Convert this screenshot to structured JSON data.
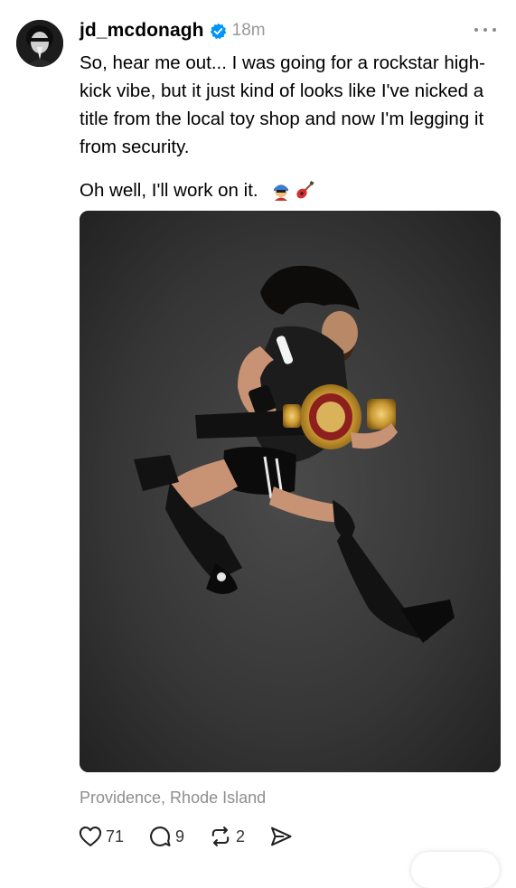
{
  "post": {
    "author": {
      "username": "jd_mcdonagh",
      "verified": true,
      "avatar_icon": "avatar-praying-hands"
    },
    "time": "18m",
    "more_icon": "ellipsis-icon",
    "text_paragraph_1": "So, hear me out... I was going for a rockstar high-kick vibe, but it just kind of looks like I've nicked a title from the local toy shop and now I'm legging it from security.",
    "text_paragraph_2": "Oh well, I'll work on it.",
    "emojis": [
      "rockstar-emoji",
      "guitar-emoji"
    ],
    "media": {
      "type": "photo",
      "subject": "wrestler-jumping-with-title-belt",
      "background_color": "#3a3a3a"
    },
    "location": "Providence, Rhode Island",
    "actions": {
      "likes": "71",
      "comments": "9",
      "reposts": "2"
    }
  },
  "colors": {
    "verified_blue": "#0095f6",
    "secondary_text": "#999999"
  }
}
